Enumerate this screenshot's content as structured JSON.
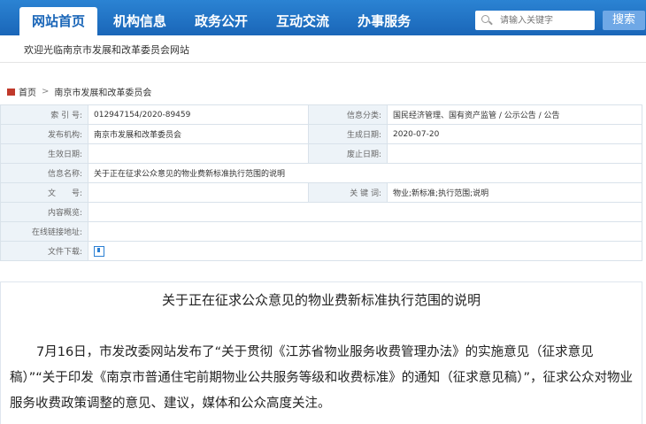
{
  "nav": {
    "items": [
      "网站首页",
      "机构信息",
      "政务公开",
      "互动交流",
      "办事服务"
    ],
    "active": 0
  },
  "search": {
    "placeholder": "请输入关键字",
    "button_label": "搜索"
  },
  "welcome_text": "欢迎光临南京市发展和改革委员会网站",
  "breadcrumb": {
    "home": "首页",
    "separator": ">",
    "current": "南京市发展和改革委员会"
  },
  "meta": {
    "index_label": "索 引 号:",
    "index_value": "012947154/2020-89459",
    "category_label": "信息分类:",
    "category_value": "国民经济管理、国有资产监管 / 公示公告 / 公告",
    "issuer_label": "发布机构:",
    "issuer_value": "南京市发展和改革委员会",
    "date_label": "生成日期:",
    "date_value": "2020-07-20",
    "effective_label": "生效日期:",
    "effective_value": "",
    "expire_label": "废止日期:",
    "expire_value": "",
    "name_label": "信息名称:",
    "name_value": "关于正在征求公众意见的物业费新标准执行范围的说明",
    "docno_label": "文　　号:",
    "docno_value": "",
    "keywords_label": "关 键 词:",
    "keywords_value": "物业;新标准;执行范围;说明",
    "summary_label": "内容概览:",
    "summary_value": "",
    "link_label": "在线链接地址:",
    "link_value": "",
    "download_label": "文件下载:"
  },
  "article": {
    "title": "关于正在征求公众意见的物业费新标准执行范围的说明",
    "body": "7月16日，市发改委网站发布了“关于贯彻《江苏省物业服务收费管理办法》的实施意见（征求意见稿）”“关于印发《南京市普通住宅前期物业公共服务等级和收费标准》的通知（征求意见稿）”，征求公众对物业服务收费政策调整的意见、建议，媒体和公众高度关注。"
  }
}
